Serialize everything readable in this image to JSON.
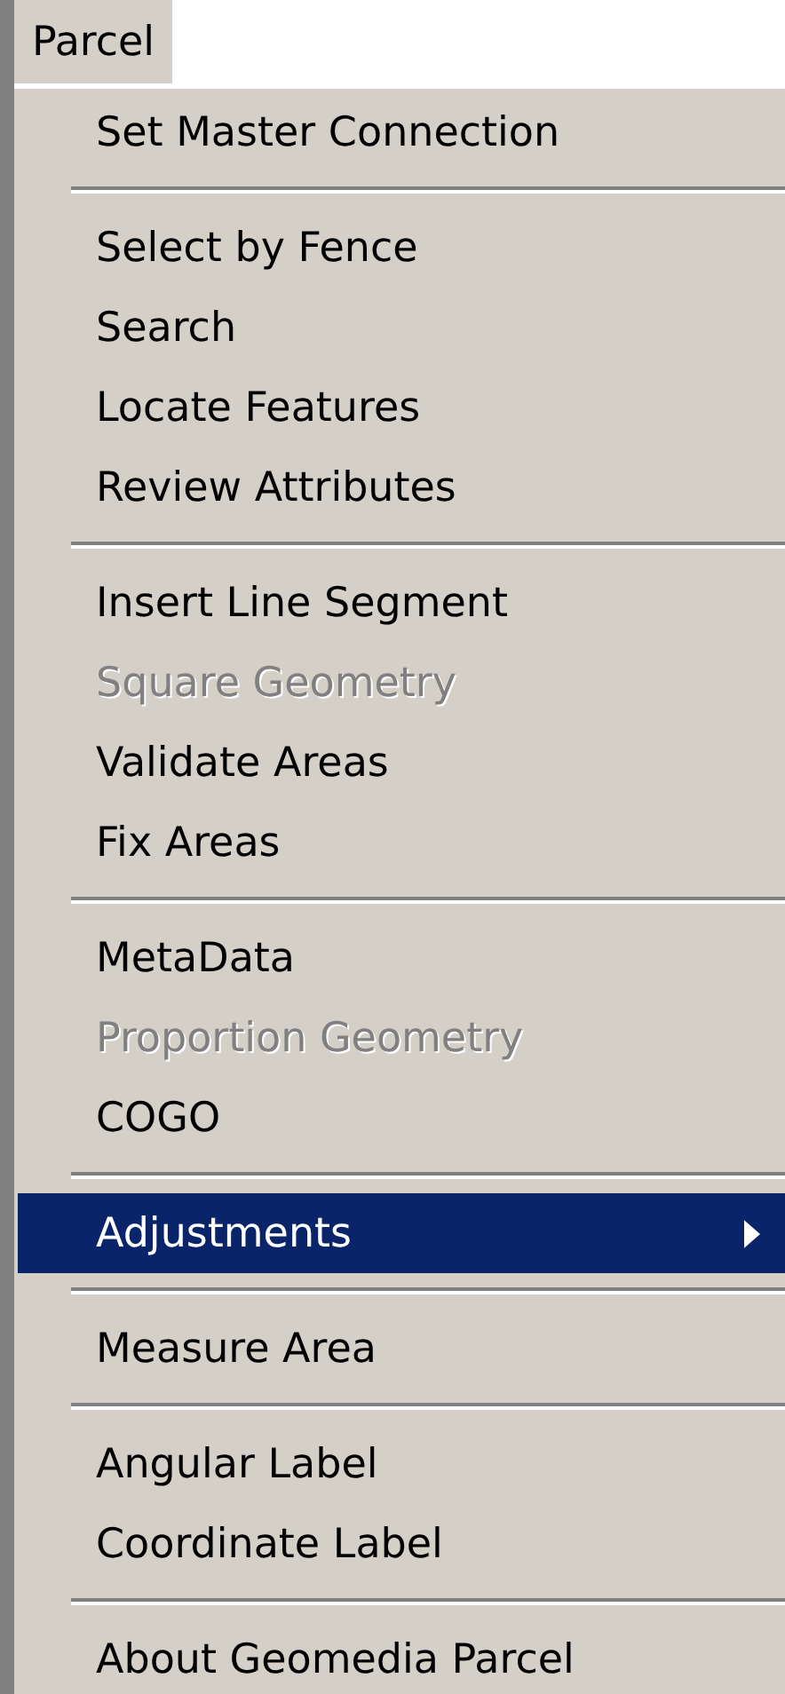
{
  "menu_bar": {
    "title": "Parcel"
  },
  "menu": {
    "groups": [
      {
        "items": [
          {
            "label": "Set Master Connection",
            "disabled": false,
            "selected": false,
            "submenu": false
          }
        ]
      },
      {
        "items": [
          {
            "label": "Select by Fence",
            "disabled": false,
            "selected": false,
            "submenu": false
          },
          {
            "label": "Search",
            "disabled": false,
            "selected": false,
            "submenu": false
          },
          {
            "label": "Locate Features",
            "disabled": false,
            "selected": false,
            "submenu": false
          },
          {
            "label": "Review Attributes",
            "disabled": false,
            "selected": false,
            "submenu": false
          }
        ]
      },
      {
        "items": [
          {
            "label": "Insert Line Segment",
            "disabled": false,
            "selected": false,
            "submenu": false
          },
          {
            "label": "Square Geometry",
            "disabled": true,
            "selected": false,
            "submenu": false
          },
          {
            "label": "Validate Areas",
            "disabled": false,
            "selected": false,
            "submenu": false
          },
          {
            "label": "Fix Areas",
            "disabled": false,
            "selected": false,
            "submenu": false
          }
        ]
      },
      {
        "items": [
          {
            "label": "MetaData",
            "disabled": false,
            "selected": false,
            "submenu": false
          },
          {
            "label": "Proportion Geometry",
            "disabled": true,
            "selected": false,
            "submenu": false
          },
          {
            "label": "COGO",
            "disabled": false,
            "selected": false,
            "submenu": false
          }
        ]
      },
      {
        "items": [
          {
            "label": "Adjustments",
            "disabled": false,
            "selected": true,
            "submenu": true
          }
        ]
      },
      {
        "items": [
          {
            "label": "Measure Area",
            "disabled": false,
            "selected": false,
            "submenu": false
          }
        ]
      },
      {
        "items": [
          {
            "label": "Angular Label",
            "disabled": false,
            "selected": false,
            "submenu": false
          },
          {
            "label": "Coordinate Label",
            "disabled": false,
            "selected": false,
            "submenu": false
          }
        ]
      },
      {
        "items": [
          {
            "label": "About Geomedia Parcel",
            "disabled": false,
            "selected": false,
            "submenu": false
          }
        ]
      }
    ]
  }
}
